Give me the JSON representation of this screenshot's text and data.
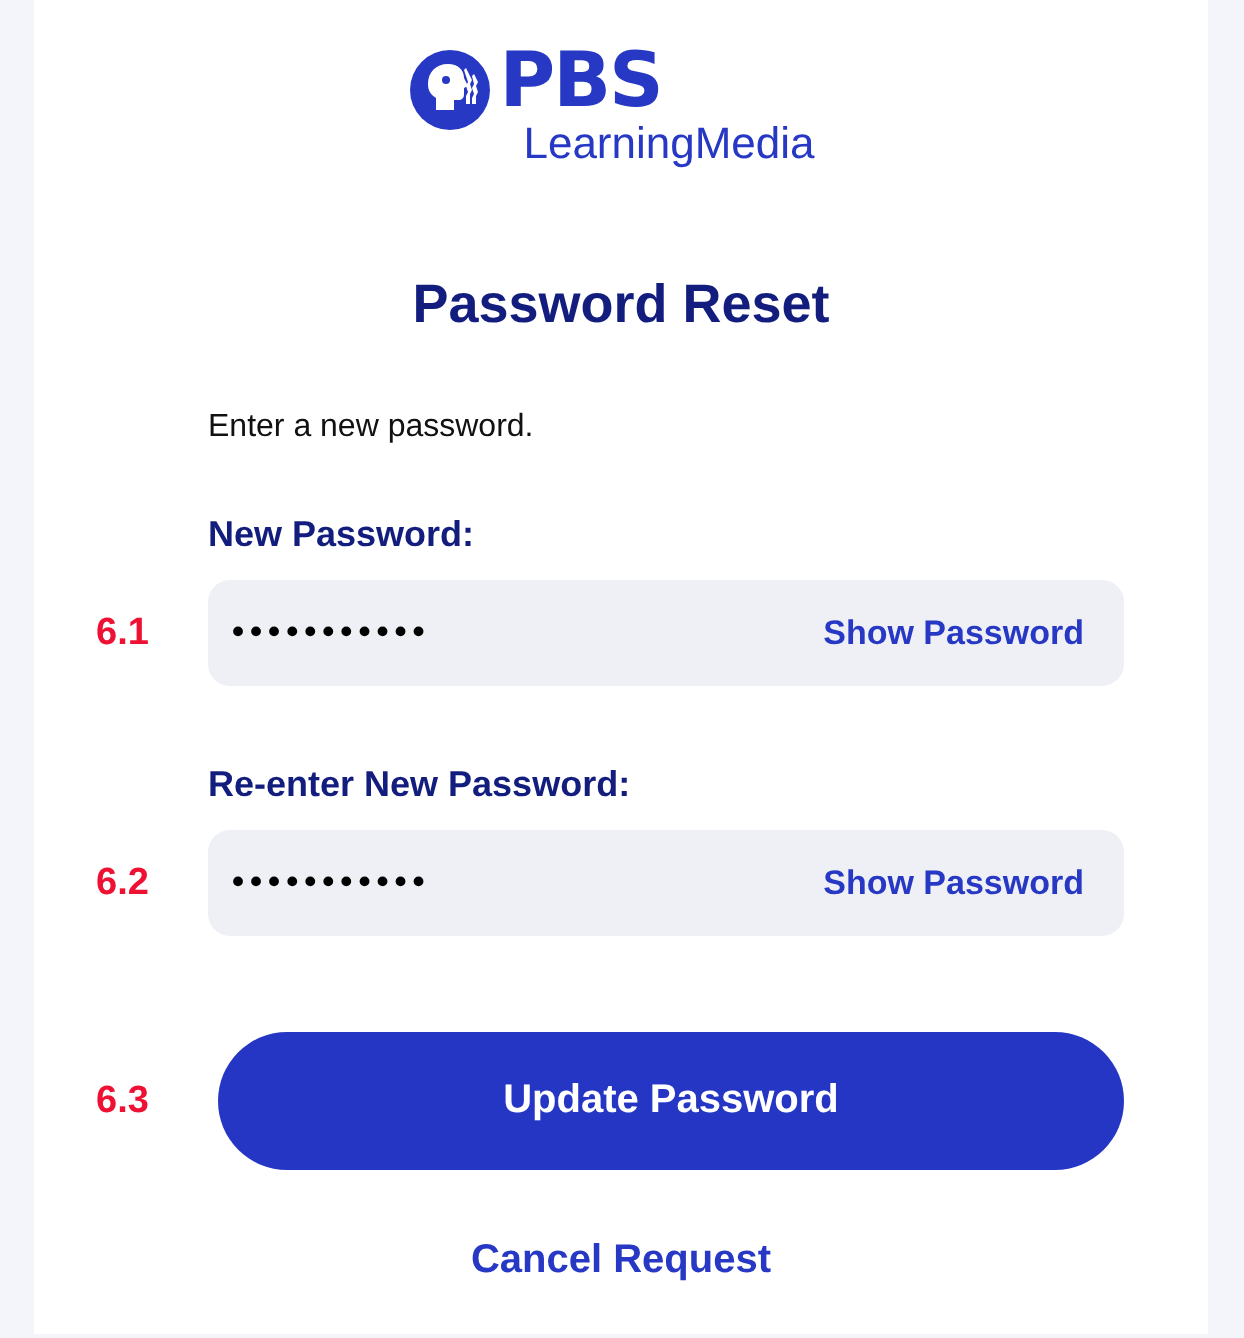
{
  "logo": {
    "wordmark": "PBS",
    "subtitle": "LearningMedia"
  },
  "title": "Password Reset",
  "instructions": "Enter a new password.",
  "fields": [
    {
      "marker": "6.1",
      "label": "New Password:",
      "value": "•••••••••••",
      "toggle": "Show Password"
    },
    {
      "marker": "6.2",
      "label": "Re-enter New Password:",
      "value": "•••••••••••",
      "toggle": "Show Password"
    }
  ],
  "submit": {
    "marker": "6.3",
    "label": "Update Password"
  },
  "cancel_link": "Cancel Request"
}
